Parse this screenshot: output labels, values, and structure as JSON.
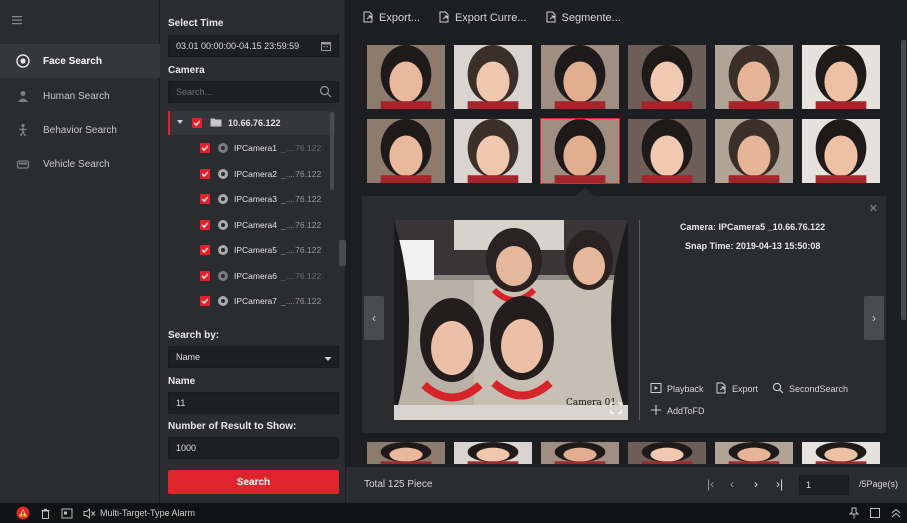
{
  "nav": {
    "items": [
      {
        "label": "Face Search",
        "icon": "face-search-icon",
        "active": true
      },
      {
        "label": "Human Search",
        "icon": "human-search-icon",
        "active": false
      },
      {
        "label": "Behavior Search",
        "icon": "behavior-search-icon",
        "active": false
      },
      {
        "label": "Vehicle Search",
        "icon": "vehicle-search-icon",
        "active": false
      }
    ]
  },
  "panel": {
    "select_time_label": "Select Time",
    "time_range": "03.01 00:00:00-04.15 23:59:59",
    "camera_label": "Camera",
    "camera_search_placeholder": "Search...",
    "device_name": "10.66.76.122",
    "cameras": [
      {
        "name": "IPCamera1",
        "ip": "_....76.122",
        "online": false
      },
      {
        "name": "IPCamera2",
        "ip": "_....76.122",
        "online": true
      },
      {
        "name": "IPCamera3",
        "ip": "_....76.122",
        "online": true
      },
      {
        "name": "IPCamera4",
        "ip": "_....76.122",
        "online": true
      },
      {
        "name": "IPCamera5",
        "ip": "_....76.122",
        "online": true
      },
      {
        "name": "IPCamera6",
        "ip": "_....76.122",
        "online": false
      },
      {
        "name": "IPCamera7",
        "ip": "_....76.122",
        "online": true
      }
    ],
    "search_by_label": "Search by:",
    "search_by_value": "Name",
    "name_label": "Name",
    "name_value": "11",
    "result_count_label": "Number of Result to Show:",
    "result_count_value": "1000",
    "search_button": "Search"
  },
  "toolbar": {
    "export": "Export...",
    "export_current": "Export Curre...",
    "segmented": "Segmente..."
  },
  "detail": {
    "camera_label": "Camera:",
    "camera_value": "IPCamera5  _10.66.76.122",
    "snap_time_label": "Snap Time:",
    "snap_time_value": "2019-04-13 15:50:08",
    "osd_text": "Camera 01",
    "playback": "Playback",
    "export": "Export",
    "second_search": "SecondSearch",
    "add_to_fd": "AddToFD"
  },
  "pagination": {
    "total": "Total 125 Piece",
    "current_page": "1",
    "page_total": "/5Page(s)"
  },
  "statusbar": {
    "alarm_label": "Multi-Target-Type Alarm"
  },
  "colors": {
    "accent": "#e0242e",
    "background": "#1d1e22",
    "panel": "#2b2c30"
  }
}
